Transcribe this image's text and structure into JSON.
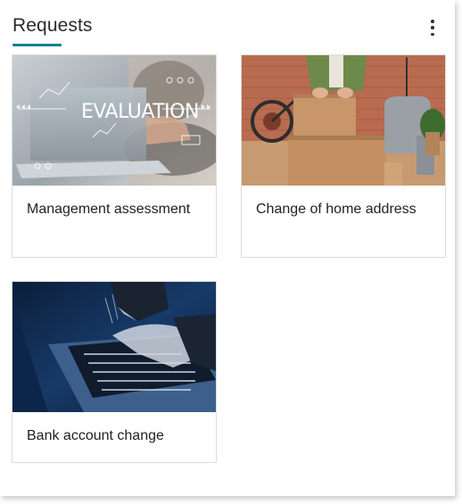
{
  "header": {
    "title": "Requests",
    "accent_color": "#00838f",
    "more_icon": "kebab-vertical-icon"
  },
  "cards": [
    {
      "label": "Management assessment",
      "image_text": "EVALUATION"
    },
    {
      "label": "Change of home address"
    },
    {
      "label": "Bank account change"
    }
  ]
}
